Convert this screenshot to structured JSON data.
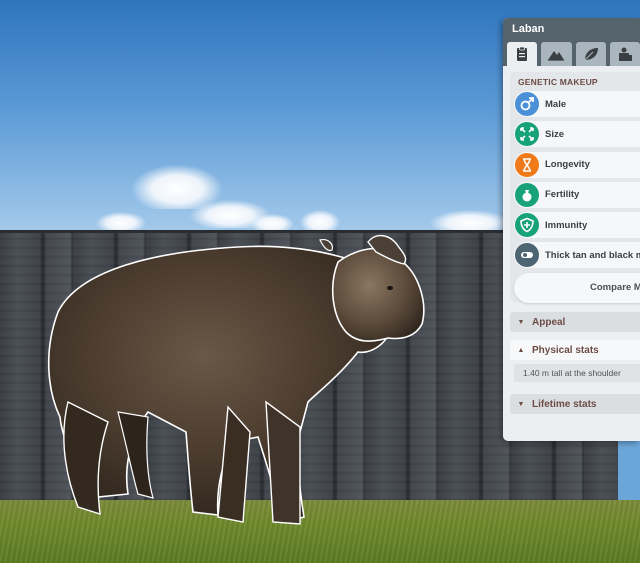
{
  "panel": {
    "title": "Laban",
    "tabs": [
      {
        "name": "info-tab",
        "icon": "clipboard-icon",
        "active": true
      },
      {
        "name": "habitat-tab",
        "icon": "mountain-icon",
        "active": false
      },
      {
        "name": "food-tab",
        "icon": "leaf-icon",
        "active": false
      },
      {
        "name": "enrichment-tab",
        "icon": "toy-icon",
        "active": false
      }
    ],
    "genetic_makeup": {
      "heading": "GENETIC MAKEUP",
      "traits": [
        {
          "label": "Male",
          "icon": "male-icon",
          "color": "#4a90d6"
        },
        {
          "label": "Size",
          "icon": "expand-icon",
          "color": "#17a27a"
        },
        {
          "label": "Longevity",
          "icon": "hourglass-icon",
          "color": "#f07a1a"
        },
        {
          "label": "Fertility",
          "icon": "fertility-icon",
          "color": "#17a27a"
        },
        {
          "label": "Immunity",
          "icon": "shield-icon",
          "color": "#17a27a"
        },
        {
          "label": "Thick tan and black m",
          "icon": "toggle-icon",
          "color": "#4d6473"
        }
      ],
      "compare_label": "Compare M"
    },
    "sections": {
      "appeal": "Appeal",
      "physical_stats": "Physical stats",
      "physical_stat_value": "1.40 m tall at the shoulder",
      "lifetime_stats": "Lifetime stats"
    }
  }
}
